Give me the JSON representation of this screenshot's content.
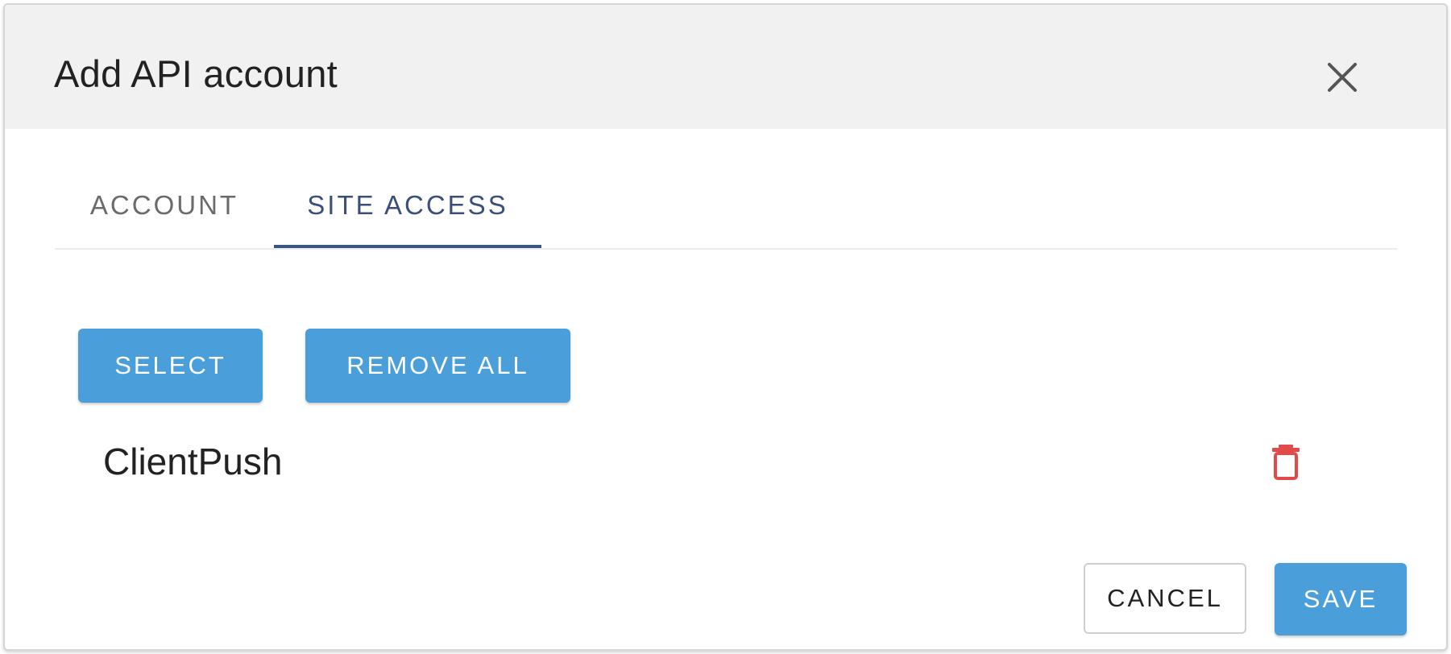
{
  "dialog": {
    "title": "Add API account",
    "close_icon": "close-icon"
  },
  "tabs": [
    {
      "label": "ACCOUNT",
      "active": false
    },
    {
      "label": "SITE ACCESS",
      "active": true
    }
  ],
  "site_access": {
    "select_label": "SELECT",
    "remove_all_label": "REMOVE ALL",
    "sites": [
      {
        "name": "ClientPush",
        "delete_icon": "trash-icon"
      }
    ]
  },
  "footer": {
    "cancel_label": "CANCEL",
    "save_label": "SAVE"
  },
  "colors": {
    "primary_button": "#4a9fdb",
    "active_tab": "#3b5486",
    "delete_icon": "#e24a4a",
    "header_background": "#f1f1f1"
  }
}
